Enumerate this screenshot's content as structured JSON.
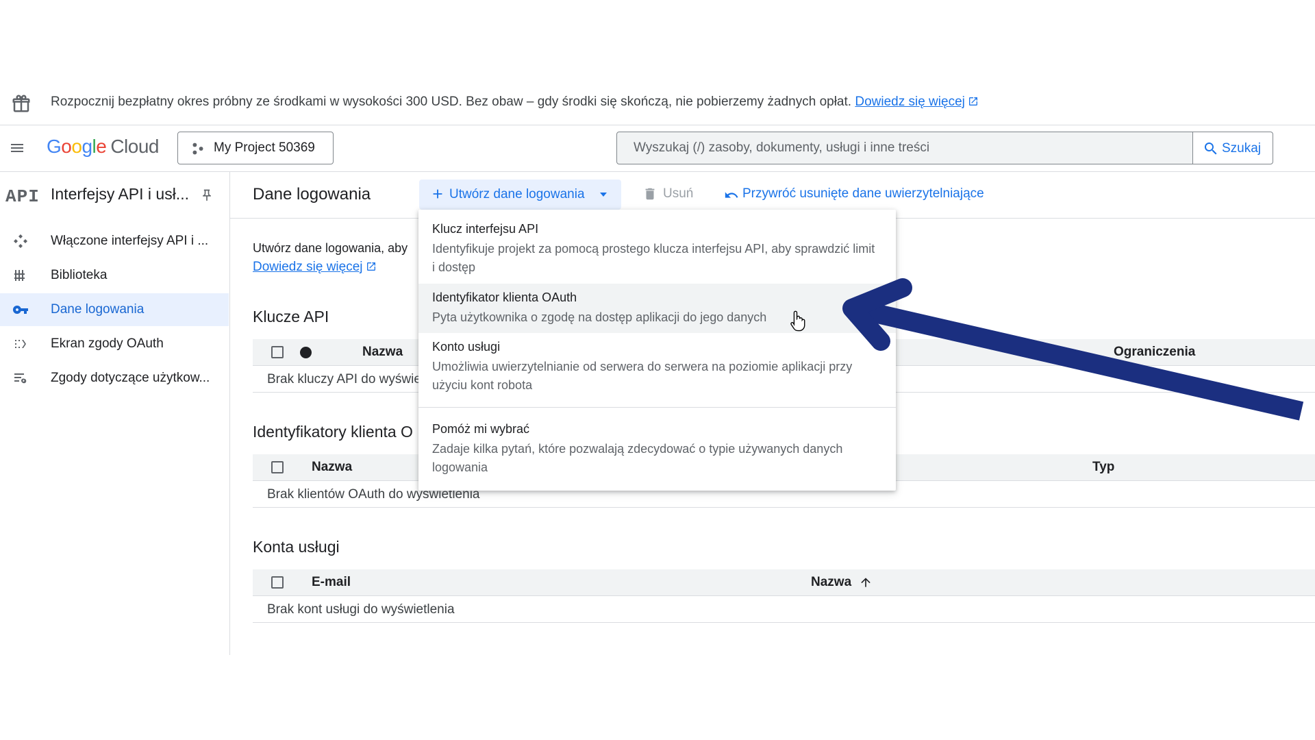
{
  "promo": {
    "text": "Rozpocznij bezpłatny okres próbny ze środkami w wysokości 300 USD. Bez obaw – gdy środki się skończą, nie pobierzemy żadnych opłat.",
    "link": "Dowiedz się więcej"
  },
  "header": {
    "logo_google": "Google",
    "logo_cloud": "Cloud",
    "project": "My Project 50369",
    "search_placeholder": "Wyszukaj (/) zasoby, dokumenty, usługi i inne treści",
    "search_button": "Szukaj"
  },
  "sidebar": {
    "badge": "API",
    "title": "Interfejsy API i usł...",
    "items": [
      {
        "label": "Włączone interfejsy API i ...",
        "icon": "apis-icon"
      },
      {
        "label": "Biblioteka",
        "icon": "library-icon"
      },
      {
        "label": "Dane logowania",
        "icon": "key-icon",
        "active": true
      },
      {
        "label": "Ekran zgody OAuth",
        "icon": "oauth-consent-icon"
      },
      {
        "label": "Zgody dotyczące użytkow...",
        "icon": "user-consent-icon"
      }
    ]
  },
  "toolbar": {
    "title": "Dane logowania",
    "create": "Utwórz dane logowania",
    "delete": "Usuń",
    "restore": "Przywróć usunięte dane uwierzytelniające"
  },
  "intro": {
    "text": "Utwórz dane logowania, aby",
    "link": "Dowiedz się więcej"
  },
  "api_keys": {
    "title": "Klucze API",
    "col_name": "Nazwa",
    "col_restrictions": "Ograniczenia",
    "empty": "Brak kluczy API do wyświe"
  },
  "oauth_clients": {
    "title": "Identyfikatory klienta O",
    "col_name": "Nazwa",
    "col_type": "Typ",
    "empty": "Brak klientów OAuth do wyświetlenia"
  },
  "service_accounts": {
    "title": "Konta usługi",
    "col_email": "E-mail",
    "col_name": "Nazwa",
    "empty": "Brak kont usługi do wyświetlenia"
  },
  "menu": {
    "items": [
      {
        "title": "Klucz interfejsu API",
        "desc": "Identyfikuje projekt za pomocą prostego klucza interfejsu API, aby sprawdzić limit i dostęp"
      },
      {
        "title": "Identyfikator klienta OAuth",
        "desc": "Pyta użytkownika o zgodę na dostęp aplikacji do jego danych"
      },
      {
        "title": "Konto usługi",
        "desc": "Umożliwia uwierzytelnianie od serwera do serwera na poziomie aplikacji przy użyciu kont robota"
      },
      {
        "title": "Pomóż mi wybrać",
        "desc": "Zadaje kilka pytań, które pozwalają zdecydować o typie używanych danych logowania"
      }
    ]
  },
  "colors": {
    "accent": "#1a73e8",
    "active_bg": "#e8f0fe",
    "annotation_arrow": "#1b2f80"
  }
}
